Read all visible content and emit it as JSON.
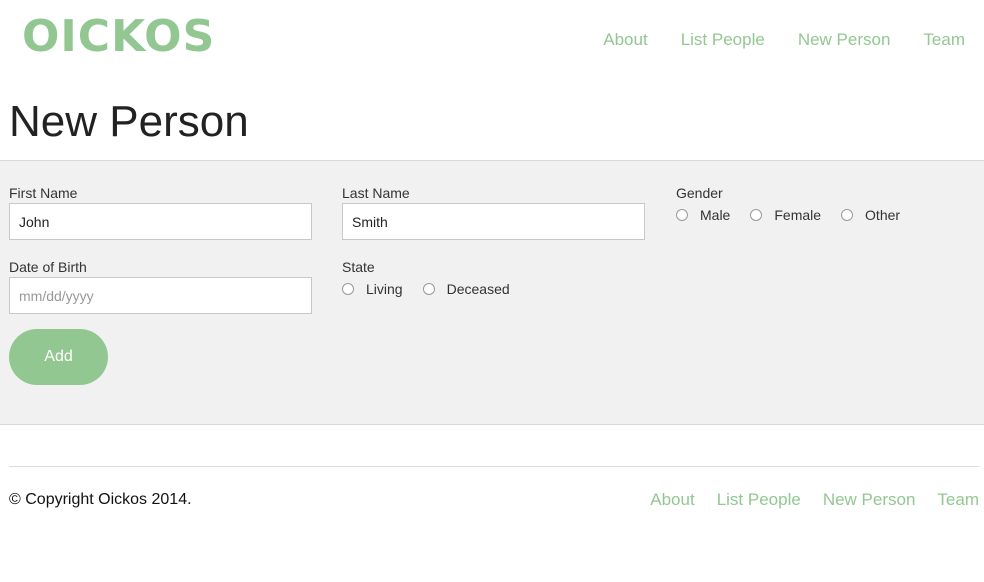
{
  "header": {
    "logo": "OICKOS",
    "nav": [
      "About",
      "List People",
      "New Person",
      "Team"
    ]
  },
  "page_title": "New Person",
  "form": {
    "first_name": {
      "label": "First Name",
      "value": "John"
    },
    "last_name": {
      "label": "Last Name",
      "value": "Smith"
    },
    "gender": {
      "label": "Gender",
      "options": [
        "Male",
        "Female",
        "Other"
      ]
    },
    "dob": {
      "label": "Date of Birth",
      "placeholder": "mm/dd/yyyy"
    },
    "state": {
      "label": "State",
      "options": [
        "Living",
        "Deceased"
      ]
    },
    "submit_label": "Add"
  },
  "footer": {
    "copyright": "© Copyright Oickos 2014.",
    "nav": [
      "About",
      "List People",
      "New Person",
      "Team"
    ]
  },
  "colors": {
    "accent": "#93c792",
    "panel_bg": "#f1f1f1"
  }
}
